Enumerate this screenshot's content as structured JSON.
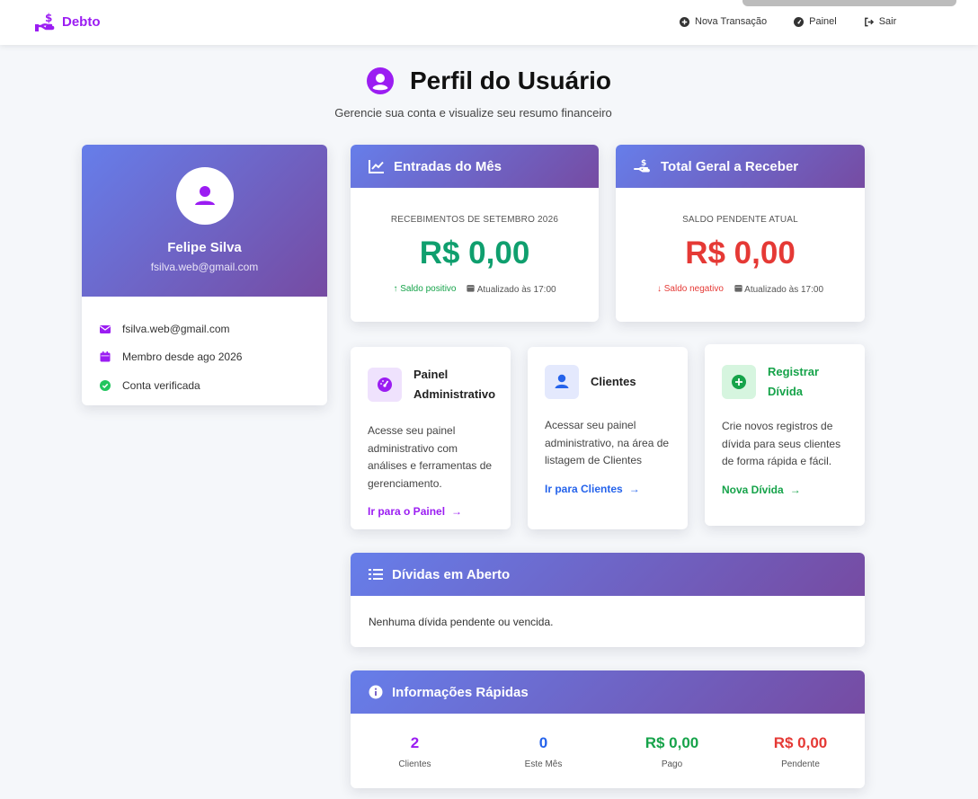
{
  "navbar": {
    "brand": "Debto",
    "links": [
      {
        "label": "Nova Transação",
        "icon": "plus-circle-icon"
      },
      {
        "label": "Painel",
        "icon": "dashboard-icon"
      },
      {
        "label": "Sair",
        "icon": "sign-out-icon"
      }
    ]
  },
  "page": {
    "title": "Perfil do Usuário",
    "subtitle": "Gerencie sua conta e visualize seu resumo financeiro"
  },
  "profile": {
    "name": "Felipe Silva",
    "email": "fsilva.web@gmail.com",
    "info": [
      {
        "icon": "envelope-icon",
        "text": "fsilva.web@gmail.com"
      },
      {
        "icon": "calendar-icon",
        "text": "Membro desde ago 2026"
      },
      {
        "icon": "check-circle-icon",
        "text": "Conta verificada"
      }
    ]
  },
  "stats": {
    "entradas": {
      "title": "Entradas do Mês",
      "label": "RECEBIMENTOS DE SETEMBRO 2026",
      "value": "R$ 0,00",
      "status": "Saldo positivo",
      "updated": "Atualizado às 17:00"
    },
    "receber": {
      "title": "Total Geral a Receber",
      "label": "SALDO PENDENTE ATUAL",
      "value": "R$ 0,00",
      "status": "Saldo negativo",
      "updated": "Atualizado às 17:00"
    }
  },
  "actions": [
    {
      "title": "Painel Administrativo",
      "desc": "Acesse seu painel administrativo com análises e ferramentas de gerenciamento.",
      "link": "Ir para o Painel"
    },
    {
      "title": "Clientes",
      "desc": "Acessar seu painel administrativo, na área de listagem de Clientes",
      "link": "Ir para Clientes"
    },
    {
      "title": "Registrar Dívida",
      "desc": "Crie novos registros de dívida para seus clientes de forma rápida e fácil.",
      "link": "Nova Dívida"
    }
  ],
  "dividas": {
    "title": "Dívidas em Aberto",
    "empty": "Nenhuma dívida pendente ou vencida."
  },
  "quick": {
    "title": "Informações Rápidas",
    "items": [
      {
        "value": "2",
        "label": "Clientes"
      },
      {
        "value": "0",
        "label": "Este Mês"
      },
      {
        "value": "R$ 0,00",
        "label": "Pago"
      },
      {
        "value": "R$ 0,00",
        "label": "Pendente"
      }
    ]
  },
  "colors": {
    "brand": "#9b1df2",
    "gradient_start": "#667eea",
    "gradient_end": "#764ba2",
    "positive": "#16a34a",
    "negative": "#e53935",
    "blue": "#2563eb"
  }
}
